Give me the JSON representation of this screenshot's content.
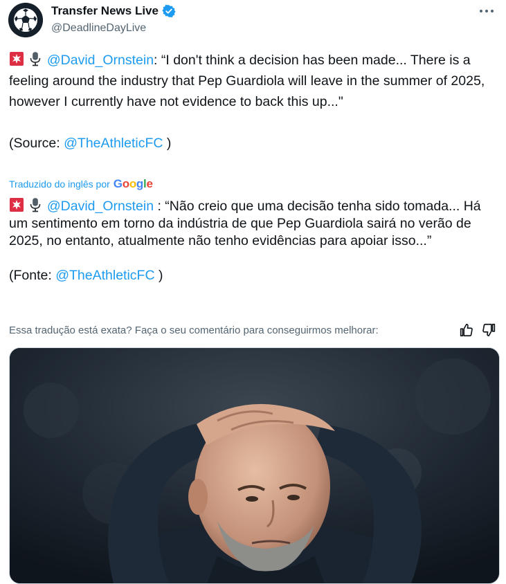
{
  "author": {
    "display_name": "Transfer News Live",
    "handle": "@DeadlineDayLive",
    "verified": true,
    "avatar_icon": "soccer-ball-icon"
  },
  "original": {
    "mention": "@David_Ornstein",
    "text_1": ": “I don't think a decision has been made... There is a feeling around the industry that Pep Guardiola will leave in the summer of 2025, however I currently have not evidence to back this up...\"",
    "source_prefix": "(Source: ",
    "source_link": "@TheAthleticFC",
    "source_suffix": " )"
  },
  "translation_label": "Traduzido do inglês por",
  "translation_provider": "Google",
  "translation": {
    "mention": "@David_Ornstein",
    "text_1": " : “Não creio que uma decisão tenha sido tomada... Há um sentimento em torno da indústria de que Pep Guardiola sairá no verão de 2025, no entanto, atualmente não tenho evidências para apoiar isso...”",
    "source_prefix": "(Fonte: ",
    "source_link": "@TheAthleticFC",
    "source_suffix": " )"
  },
  "feedback": {
    "question": "Essa tradução está exata? Faça o seu comentário para conseguirmos melhorar:",
    "like_icon": "thumbs-up-icon",
    "dislike_icon": "thumbs-down-icon"
  },
  "colors": {
    "link": "#1d9bf0",
    "verified": "#1d9bf0",
    "text": "#0f1419",
    "secondary": "#536471"
  }
}
